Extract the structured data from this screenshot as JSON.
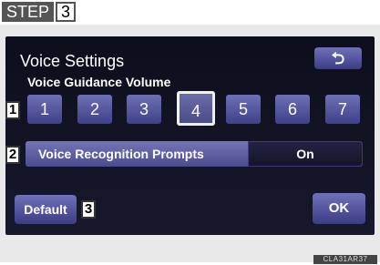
{
  "step": {
    "word": "STEP",
    "number": "3"
  },
  "screen": {
    "title": "Voice Settings",
    "back_icon": "return-arrow-icon",
    "back_glyph": "⮌",
    "volume": {
      "label": "Voice Guidance Volume",
      "levels": [
        "1",
        "2",
        "3",
        "4",
        "5",
        "6",
        "7"
      ],
      "selected": "4"
    },
    "voice_recognition": {
      "label": "Voice Recognition Prompts",
      "value": "On"
    },
    "default_label": "Default",
    "ok_label": "OK"
  },
  "callouts": [
    "1",
    "2",
    "3"
  ],
  "figure_code": "CLA31AR37"
}
